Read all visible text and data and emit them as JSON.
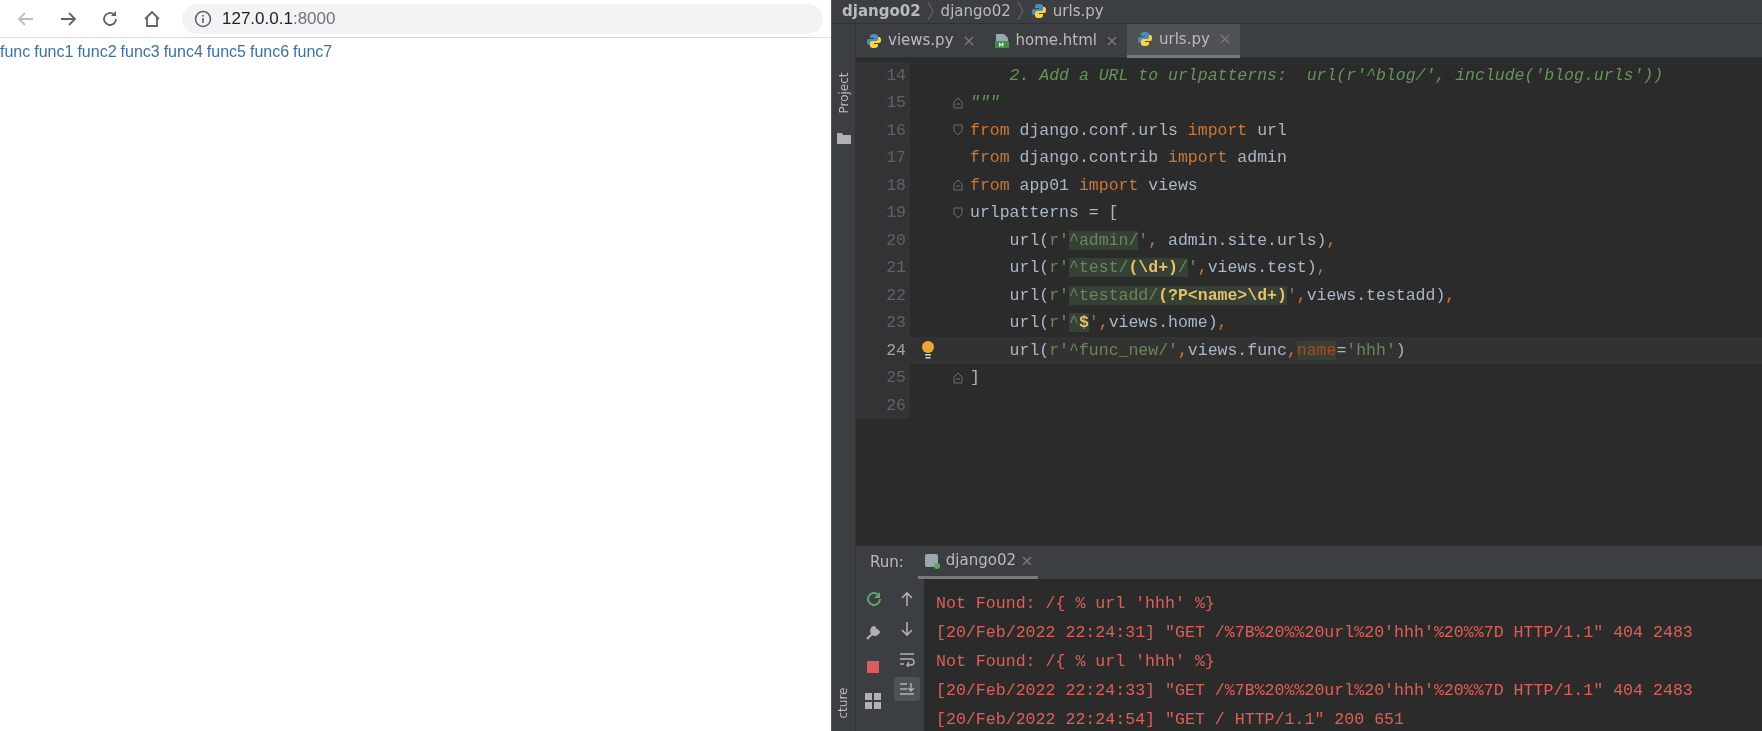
{
  "browser": {
    "nav_buttons": [
      {
        "kind": "back",
        "disabled": true
      },
      {
        "kind": "forward",
        "disabled": false
      },
      {
        "kind": "reload",
        "disabled": false
      },
      {
        "kind": "home",
        "disabled": false
      }
    ],
    "address": {
      "host": "127.0.0.1",
      "port": ":8000"
    },
    "links": [
      "func",
      "func1",
      "func2",
      "func3",
      "func4",
      "func5",
      "func6",
      "func7"
    ]
  },
  "ide": {
    "breadcrumbs": [
      {
        "label": "django02",
        "kind": "project",
        "bold": true
      },
      {
        "label": "django02",
        "kind": "folder",
        "bold": false
      },
      {
        "label": "urls.py",
        "kind": "python",
        "bold": false
      }
    ],
    "tool_strip": {
      "top": "Project",
      "bottom": "cture"
    },
    "tabs": [
      {
        "label": "views.py",
        "kind": "python",
        "selected": false
      },
      {
        "label": "home.html",
        "kind": "html",
        "selected": false
      },
      {
        "label": "urls.py",
        "kind": "python",
        "selected": true
      }
    ],
    "lines": [
      {
        "num": "14",
        "current": false,
        "bulb": false,
        "fold_start": false,
        "fold_end": false,
        "segs": [
          {
            "kind": "comment",
            "text": "    2. Add a URL to urlpatterns:  url(r'^blog/', include('blog.urls'))"
          }
        ]
      },
      {
        "num": "15",
        "current": false,
        "bulb": false,
        "fold_start": false,
        "fold_end": true,
        "segs": [
          {
            "kind": "comment",
            "text": "\"\"\""
          }
        ]
      },
      {
        "num": "16",
        "current": false,
        "bulb": false,
        "fold_start": true,
        "fold_end": false,
        "segs": [
          {
            "kind": "keyword",
            "text": "from"
          },
          {
            "kind": "plain",
            "text": " django.conf.urls "
          },
          {
            "kind": "keyword",
            "text": "import"
          },
          {
            "kind": "plain",
            "text": " url"
          }
        ]
      },
      {
        "num": "17",
        "current": false,
        "bulb": false,
        "fold_start": false,
        "fold_end": false,
        "segs": [
          {
            "kind": "keyword",
            "text": "from"
          },
          {
            "kind": "plain",
            "text": " django.contrib "
          },
          {
            "kind": "keyword",
            "text": "import"
          },
          {
            "kind": "plain",
            "text": " admin"
          }
        ]
      },
      {
        "num": "18",
        "current": false,
        "bulb": false,
        "fold_start": false,
        "fold_end": true,
        "segs": [
          {
            "kind": "keyword",
            "text": "from"
          },
          {
            "kind": "plain",
            "text": " app01 "
          },
          {
            "kind": "keyword",
            "text": "import"
          },
          {
            "kind": "plain",
            "text": " views"
          }
        ]
      },
      {
        "num": "19",
        "current": false,
        "bulb": false,
        "fold_start": true,
        "fold_end": false,
        "segs": [
          {
            "kind": "plain",
            "text": "urlpatterns = ["
          }
        ]
      },
      {
        "num": "20",
        "current": false,
        "bulb": false,
        "fold_start": false,
        "fold_end": false,
        "segs": [
          {
            "kind": "plain",
            "text": "    url("
          },
          {
            "kind": "string",
            "text": "r'"
          },
          {
            "kind": "regex",
            "text": "^admin/"
          },
          {
            "kind": "string",
            "text": "'"
          },
          {
            "kind": "comma",
            "text": ","
          },
          {
            "kind": "plain",
            "text": " admin.site.urls)"
          },
          {
            "kind": "comma",
            "text": ","
          }
        ]
      },
      {
        "num": "21",
        "current": false,
        "bulb": false,
        "fold_start": false,
        "fold_end": false,
        "segs": [
          {
            "kind": "plain",
            "text": "    url("
          },
          {
            "kind": "string",
            "text": "r'"
          },
          {
            "kind": "regex",
            "text": "^test/"
          },
          {
            "kind": "group",
            "text": "(\\d+)"
          },
          {
            "kind": "regex",
            "text": "/"
          },
          {
            "kind": "string",
            "text": "'"
          },
          {
            "kind": "comma",
            "text": ","
          },
          {
            "kind": "plain",
            "text": "views.test)"
          },
          {
            "kind": "comma",
            "text": ","
          }
        ]
      },
      {
        "num": "22",
        "current": false,
        "bulb": false,
        "fold_start": false,
        "fold_end": false,
        "segs": [
          {
            "kind": "plain",
            "text": "    url("
          },
          {
            "kind": "string",
            "text": "r'"
          },
          {
            "kind": "regex",
            "text": "^testadd/"
          },
          {
            "kind": "group",
            "text": "(?P<name>\\d+)"
          },
          {
            "kind": "string",
            "text": "'"
          },
          {
            "kind": "comma",
            "text": ","
          },
          {
            "kind": "plain",
            "text": "views.testadd)"
          },
          {
            "kind": "comma",
            "text": ","
          }
        ]
      },
      {
        "num": "23",
        "current": false,
        "bulb": false,
        "fold_start": false,
        "fold_end": false,
        "segs": [
          {
            "kind": "plain",
            "text": "    url("
          },
          {
            "kind": "string",
            "text": "r'"
          },
          {
            "kind": "regex",
            "text": "^"
          },
          {
            "kind": "group",
            "text": "$"
          },
          {
            "kind": "string",
            "text": "'"
          },
          {
            "kind": "comma",
            "text": ","
          },
          {
            "kind": "plain",
            "text": "views.home)"
          },
          {
            "kind": "comma",
            "text": ","
          }
        ]
      },
      {
        "num": "24",
        "current": true,
        "bulb": true,
        "fold_start": false,
        "fold_end": false,
        "segs": [
          {
            "kind": "plain",
            "text": "    url("
          },
          {
            "kind": "string",
            "text": "r'^func_new/'"
          },
          {
            "kind": "comma",
            "text": ","
          },
          {
            "kind": "plain",
            "text": "views.func"
          },
          {
            "kind": "comma",
            "text": ","
          },
          {
            "kind": "param",
            "text": "name"
          },
          {
            "kind": "plain",
            "text": "="
          },
          {
            "kind": "string",
            "text": "'hhh'"
          },
          {
            "kind": "plain",
            "text": ")"
          }
        ]
      },
      {
        "num": "25",
        "current": false,
        "bulb": false,
        "fold_start": false,
        "fold_end": true,
        "segs": [
          {
            "kind": "plain",
            "text": "]"
          }
        ]
      },
      {
        "num": "26",
        "current": false,
        "bulb": false,
        "fold_start": false,
        "fold_end": false
      }
    ],
    "run": {
      "label": "Run:",
      "tab": {
        "label": "django02",
        "selected": true
      },
      "left_tools": [
        {
          "kind": "rerun"
        },
        {
          "kind": "wrench"
        },
        {
          "kind": "stop"
        },
        {
          "kind": "layout"
        }
      ],
      "right_tools": [
        {
          "kind": "up",
          "selected": false
        },
        {
          "kind": "down",
          "selected": false
        },
        {
          "kind": "wrap",
          "selected": false
        },
        {
          "kind": "scroll-end",
          "selected": true
        }
      ],
      "log": [
        "Not Found: /{ % url 'hhh' %}",
        "[20/Feb/2022 22:24:31] \"GET /%7B%20%%20url%20'hhh'%20%%7D HTTP/1.1\" 404 2483",
        "Not Found: /{ % url 'hhh' %}",
        "[20/Feb/2022 22:24:33] \"GET /%7B%20%%20url%20'hhh'%20%%7D HTTP/1.1\" 404 2483",
        "[20/Feb/2022 22:24:54] \"GET / HTTP/1.1\" 200 651"
      ]
    }
  }
}
